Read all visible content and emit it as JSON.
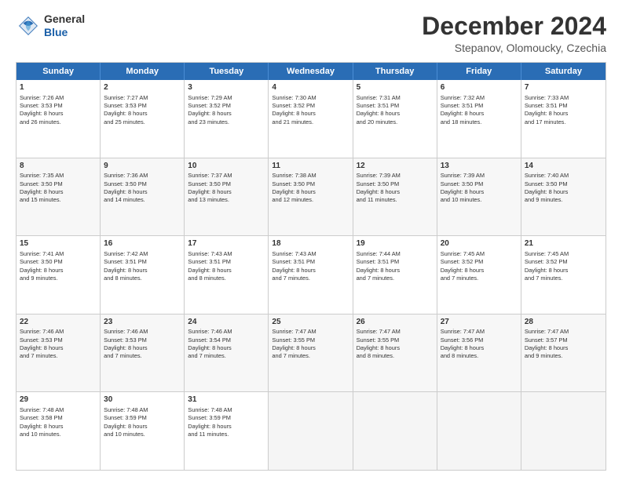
{
  "logo": {
    "general": "General",
    "blue": "Blue"
  },
  "header": {
    "month": "December 2024",
    "location": "Stepanov, Olomoucky, Czechia"
  },
  "weekdays": [
    "Sunday",
    "Monday",
    "Tuesday",
    "Wednesday",
    "Thursday",
    "Friday",
    "Saturday"
  ],
  "rows": [
    [
      {
        "day": "1",
        "lines": [
          "Sunrise: 7:26 AM",
          "Sunset: 3:53 PM",
          "Daylight: 8 hours",
          "and 26 minutes."
        ]
      },
      {
        "day": "2",
        "lines": [
          "Sunrise: 7:27 AM",
          "Sunset: 3:53 PM",
          "Daylight: 8 hours",
          "and 25 minutes."
        ]
      },
      {
        "day": "3",
        "lines": [
          "Sunrise: 7:29 AM",
          "Sunset: 3:52 PM",
          "Daylight: 8 hours",
          "and 23 minutes."
        ]
      },
      {
        "day": "4",
        "lines": [
          "Sunrise: 7:30 AM",
          "Sunset: 3:52 PM",
          "Daylight: 8 hours",
          "and 21 minutes."
        ]
      },
      {
        "day": "5",
        "lines": [
          "Sunrise: 7:31 AM",
          "Sunset: 3:51 PM",
          "Daylight: 8 hours",
          "and 20 minutes."
        ]
      },
      {
        "day": "6",
        "lines": [
          "Sunrise: 7:32 AM",
          "Sunset: 3:51 PM",
          "Daylight: 8 hours",
          "and 18 minutes."
        ]
      },
      {
        "day": "7",
        "lines": [
          "Sunrise: 7:33 AM",
          "Sunset: 3:51 PM",
          "Daylight: 8 hours",
          "and 17 minutes."
        ]
      }
    ],
    [
      {
        "day": "8",
        "lines": [
          "Sunrise: 7:35 AM",
          "Sunset: 3:50 PM",
          "Daylight: 8 hours",
          "and 15 minutes."
        ]
      },
      {
        "day": "9",
        "lines": [
          "Sunrise: 7:36 AM",
          "Sunset: 3:50 PM",
          "Daylight: 8 hours",
          "and 14 minutes."
        ]
      },
      {
        "day": "10",
        "lines": [
          "Sunrise: 7:37 AM",
          "Sunset: 3:50 PM",
          "Daylight: 8 hours",
          "and 13 minutes."
        ]
      },
      {
        "day": "11",
        "lines": [
          "Sunrise: 7:38 AM",
          "Sunset: 3:50 PM",
          "Daylight: 8 hours",
          "and 12 minutes."
        ]
      },
      {
        "day": "12",
        "lines": [
          "Sunrise: 7:39 AM",
          "Sunset: 3:50 PM",
          "Daylight: 8 hours",
          "and 11 minutes."
        ]
      },
      {
        "day": "13",
        "lines": [
          "Sunrise: 7:39 AM",
          "Sunset: 3:50 PM",
          "Daylight: 8 hours",
          "and 10 minutes."
        ]
      },
      {
        "day": "14",
        "lines": [
          "Sunrise: 7:40 AM",
          "Sunset: 3:50 PM",
          "Daylight: 8 hours",
          "and 9 minutes."
        ]
      }
    ],
    [
      {
        "day": "15",
        "lines": [
          "Sunrise: 7:41 AM",
          "Sunset: 3:50 PM",
          "Daylight: 8 hours",
          "and 9 minutes."
        ]
      },
      {
        "day": "16",
        "lines": [
          "Sunrise: 7:42 AM",
          "Sunset: 3:51 PM",
          "Daylight: 8 hours",
          "and 8 minutes."
        ]
      },
      {
        "day": "17",
        "lines": [
          "Sunrise: 7:43 AM",
          "Sunset: 3:51 PM",
          "Daylight: 8 hours",
          "and 8 minutes."
        ]
      },
      {
        "day": "18",
        "lines": [
          "Sunrise: 7:43 AM",
          "Sunset: 3:51 PM",
          "Daylight: 8 hours",
          "and 7 minutes."
        ]
      },
      {
        "day": "19",
        "lines": [
          "Sunrise: 7:44 AM",
          "Sunset: 3:51 PM",
          "Daylight: 8 hours",
          "and 7 minutes."
        ]
      },
      {
        "day": "20",
        "lines": [
          "Sunrise: 7:45 AM",
          "Sunset: 3:52 PM",
          "Daylight: 8 hours",
          "and 7 minutes."
        ]
      },
      {
        "day": "21",
        "lines": [
          "Sunrise: 7:45 AM",
          "Sunset: 3:52 PM",
          "Daylight: 8 hours",
          "and 7 minutes."
        ]
      }
    ],
    [
      {
        "day": "22",
        "lines": [
          "Sunrise: 7:46 AM",
          "Sunset: 3:53 PM",
          "Daylight: 8 hours",
          "and 7 minutes."
        ]
      },
      {
        "day": "23",
        "lines": [
          "Sunrise: 7:46 AM",
          "Sunset: 3:53 PM",
          "Daylight: 8 hours",
          "and 7 minutes."
        ]
      },
      {
        "day": "24",
        "lines": [
          "Sunrise: 7:46 AM",
          "Sunset: 3:54 PM",
          "Daylight: 8 hours",
          "and 7 minutes."
        ]
      },
      {
        "day": "25",
        "lines": [
          "Sunrise: 7:47 AM",
          "Sunset: 3:55 PM",
          "Daylight: 8 hours",
          "and 7 minutes."
        ]
      },
      {
        "day": "26",
        "lines": [
          "Sunrise: 7:47 AM",
          "Sunset: 3:55 PM",
          "Daylight: 8 hours",
          "and 8 minutes."
        ]
      },
      {
        "day": "27",
        "lines": [
          "Sunrise: 7:47 AM",
          "Sunset: 3:56 PM",
          "Daylight: 8 hours",
          "and 8 minutes."
        ]
      },
      {
        "day": "28",
        "lines": [
          "Sunrise: 7:47 AM",
          "Sunset: 3:57 PM",
          "Daylight: 8 hours",
          "and 9 minutes."
        ]
      }
    ],
    [
      {
        "day": "29",
        "lines": [
          "Sunrise: 7:48 AM",
          "Sunset: 3:58 PM",
          "Daylight: 8 hours",
          "and 10 minutes."
        ]
      },
      {
        "day": "30",
        "lines": [
          "Sunrise: 7:48 AM",
          "Sunset: 3:59 PM",
          "Daylight: 8 hours",
          "and 10 minutes."
        ]
      },
      {
        "day": "31",
        "lines": [
          "Sunrise: 7:48 AM",
          "Sunset: 3:59 PM",
          "Daylight: 8 hours",
          "and 11 minutes."
        ]
      },
      {
        "day": "",
        "lines": []
      },
      {
        "day": "",
        "lines": []
      },
      {
        "day": "",
        "lines": []
      },
      {
        "day": "",
        "lines": []
      }
    ]
  ]
}
